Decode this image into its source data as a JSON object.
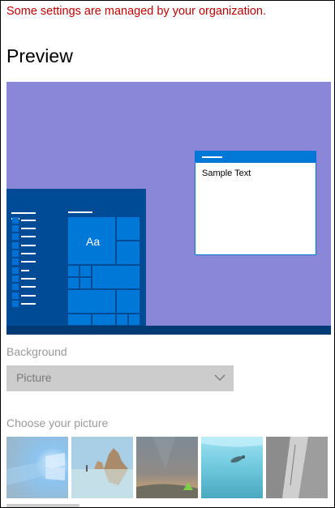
{
  "notice": "Some settings are managed by your organization.",
  "preview": {
    "heading": "Preview",
    "sample_text": "Sample Text",
    "tile_label": "Aa"
  },
  "background": {
    "label": "Background",
    "selected": "Picture"
  },
  "choose_picture": {
    "label": "Choose your picture",
    "thumbnails": [
      "windows-light-wallpaper",
      "beach-rocks-reflection",
      "night-sky-tent",
      "underwater-swimmer",
      "rock-cliff"
    ]
  },
  "colors": {
    "notice": "#c00000",
    "accent": "#0078d7",
    "preview_bg": "#8a87d8",
    "startmenu": "#004b95",
    "taskbar": "#003a74"
  }
}
